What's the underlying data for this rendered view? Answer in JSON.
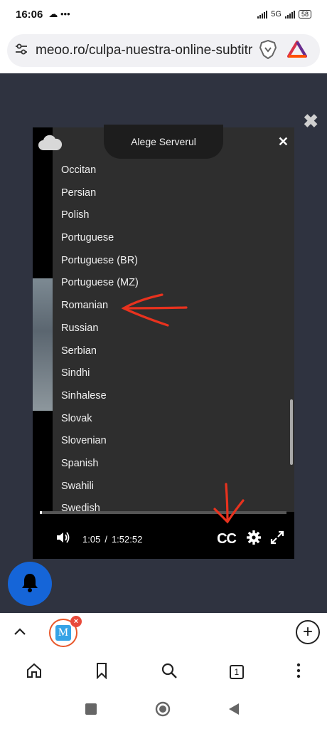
{
  "status_bar": {
    "time": "16:06",
    "left_icons": "☁ •••",
    "net_label": "5G",
    "battery": "58"
  },
  "browser": {
    "url": "meoo.ro/culpa-nuestra-online-subtitra"
  },
  "player": {
    "server_label": "Alege Serverul",
    "languages": [
      "Occitan",
      "Persian",
      "Polish",
      "Portuguese",
      "Portuguese (BR)",
      "Portuguese (MZ)",
      "Romanian",
      "Russian",
      "Serbian",
      "Sindhi",
      "Sinhalese",
      "Slovak",
      "Slovenian",
      "Spanish",
      "Swahili",
      "Swedish"
    ],
    "current_time": "1:05",
    "separator": "/",
    "total_time": "1:52:52",
    "cc_label": "CC",
    "progress": 0.01
  },
  "tabs": {
    "open_count": "1",
    "tab_letter": "M",
    "tab_close": "×",
    "new_tab": "+"
  },
  "colors": {
    "accent_blue": "#1565d8",
    "annotation_red": "#e8321e",
    "page_bg": "#2f3340"
  }
}
